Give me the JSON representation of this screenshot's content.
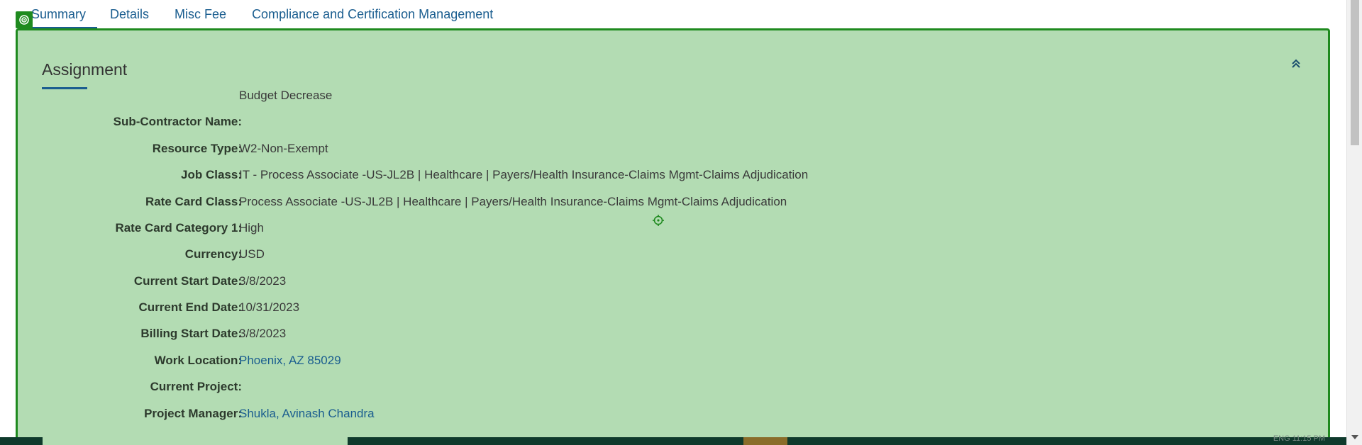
{
  "tabs": [
    {
      "label": "Summary",
      "active": true
    },
    {
      "label": "Details",
      "active": false
    },
    {
      "label": "Misc Fee",
      "active": false
    },
    {
      "label": "Compliance and Certification Management",
      "active": false
    }
  ],
  "section": {
    "title": "Assignment"
  },
  "fields": [
    {
      "label": "",
      "value": "Budget Decrease",
      "link": false
    },
    {
      "label": "Sub-Contractor Name:",
      "value": "",
      "link": false
    },
    {
      "label": "Resource Type:",
      "value": "W2-Non-Exempt",
      "link": false
    },
    {
      "label": "Job Class:",
      "value": "IT - Process Associate -US-JL2B | Healthcare | Payers/Health Insurance-Claims Mgmt-Claims Adjudication",
      "link": false
    },
    {
      "label": "Rate Card Class:",
      "value": "Process Associate -US-JL2B | Healthcare | Payers/Health Insurance-Claims Mgmt-Claims Adjudication",
      "link": false
    },
    {
      "label": "Rate Card Category 1:",
      "value": "High",
      "link": false
    },
    {
      "label": "Currency:",
      "value": "USD",
      "link": false
    },
    {
      "label": "Current Start Date:",
      "value": "3/8/2023",
      "link": false
    },
    {
      "label": "Current End Date:",
      "value": "10/31/2023",
      "link": false
    },
    {
      "label": "Billing Start Date:",
      "value": "3/8/2023",
      "link": false
    },
    {
      "label": "Work Location:",
      "value": "Phoenix, AZ 85029",
      "link": true
    },
    {
      "label": "Current Project:",
      "value": "",
      "link": false
    },
    {
      "label": "Project Manager:",
      "value": "Shukla, Avinash Chandra",
      "link": true
    }
  ],
  "icons": {
    "collapse": "double-chevron-up-icon",
    "target": "target-icon",
    "crosshair": "crosshair-icon"
  },
  "colors": {
    "panel_bg": "#b3dcb3",
    "panel_border": "#1f8a1f",
    "link": "#1a5d8f"
  },
  "taskbar": {
    "clock": "ENG  11:15 PM"
  }
}
